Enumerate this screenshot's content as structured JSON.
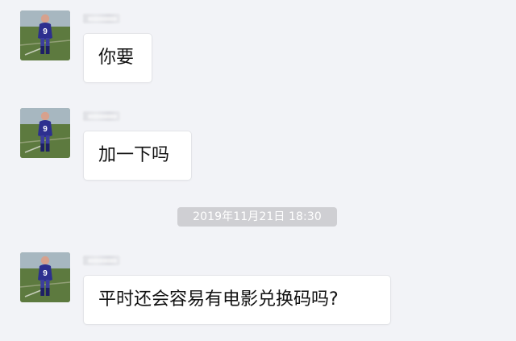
{
  "messages": [
    {
      "sender": "",
      "text": "你要"
    },
    {
      "sender": "",
      "text": "加一下吗"
    },
    {
      "sender": "",
      "text": "平时还会容易有电影兑换码吗?"
    }
  ],
  "timestamp": "2019年11月21日 18:30",
  "colors": {
    "background": "#f2f3f7",
    "bubble": "#ffffff",
    "timestamp_bg": "#cfcfd3",
    "jersey": "#2d2f8f",
    "grass": "#5c7a3f"
  },
  "icons": {
    "avatar": "soccer-player-avatar-icon"
  }
}
